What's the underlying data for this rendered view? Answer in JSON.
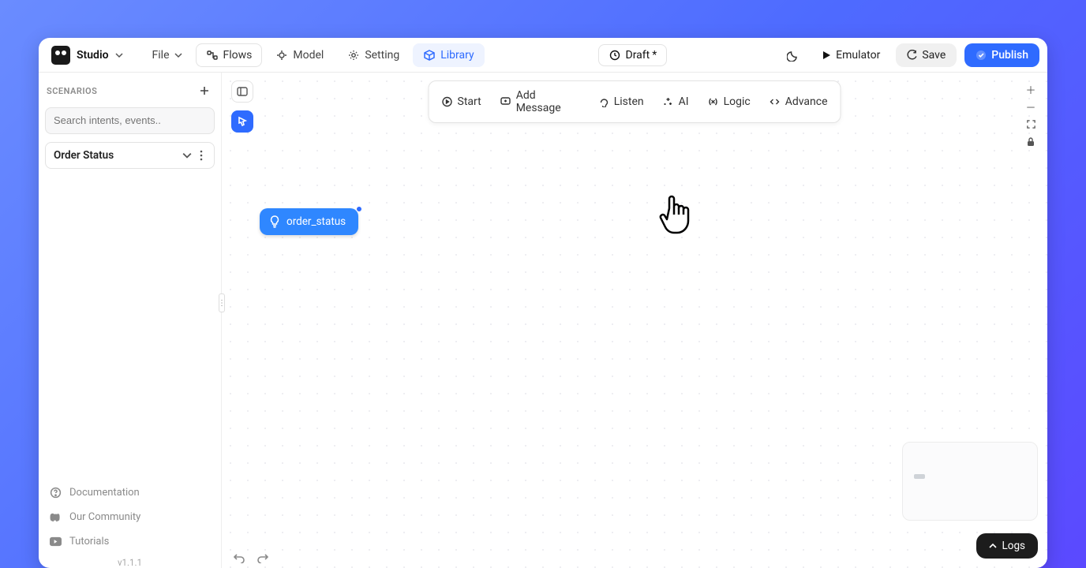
{
  "brand": {
    "name": "Studio"
  },
  "topnav": {
    "file": "File",
    "flows": "Flows",
    "model": "Model",
    "setting": "Setting",
    "library": "Library"
  },
  "status": {
    "draft_label": "Draft",
    "draft_dirty_marker": "*"
  },
  "actions": {
    "emulator": "Emulator",
    "save": "Save",
    "publish": "Publish"
  },
  "sidebar": {
    "heading": "SCENARIOS",
    "search_placeholder": "Search intents, events..",
    "scenario_name": "Order Status",
    "links": {
      "documentation": "Documentation",
      "community": "Our Community",
      "tutorials": "Tutorials"
    },
    "version": "v1.1.1"
  },
  "canvas_toolbar": {
    "start": "Start",
    "add_message": "Add Message",
    "listen": "Listen",
    "ai": "AI",
    "logic": "Logic",
    "advance": "Advance"
  },
  "node": {
    "label": "order_status"
  },
  "logs": {
    "label": "Logs"
  },
  "collapse_handle_glyph": "⋮"
}
